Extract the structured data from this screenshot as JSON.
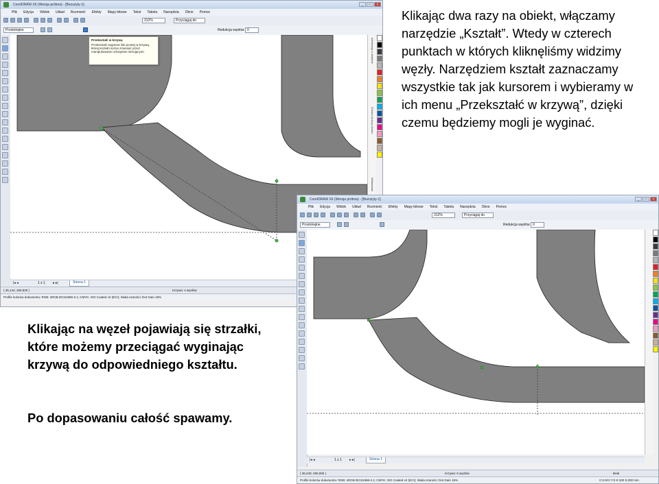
{
  "captions": {
    "top": "Klikając dwa razy na obiekt, włączamy narzędzie „Kształt”. Wtedy w czterech punktach w których kliknęliśmy widzimy węzły. Narzędziem kształt zaznaczamy wszystkie tak jak kursorem i wybieramy w ich menu „Przekształć w krzywą”, dzięki czemu będziemy mogli je wyginać.",
    "bottom": "Klikając na węzeł pojawiają się strzałki, które możemy przeciągać wyginając krzywą do odpowiedniego kształtu.",
    "final": "Po dopasowaniu całość spawamy."
  },
  "screenshot1": {
    "title": "CorelDRAW X6 (Wersja próbna) - [Bezużyty-1]",
    "menu": [
      "Plik",
      "Edycja",
      "Widok",
      "Układ",
      "Rozmieść",
      "Efekty",
      "Mapy bitowe",
      "Tekst",
      "Tabela",
      "Narzędzia",
      "Okno",
      "Pomoc"
    ],
    "zoom": "312%",
    "snap_label": "Przyciągaj do",
    "preset": "Prostokątne",
    "node_reduction_label": "Redukcja węzłów",
    "node_reduction_value": "0",
    "tooltip_title": "Przekształć w krzywą",
    "tooltip_text": "Przekształć segment linii prostej w krzywą, której kształt można zmieniać przez manipulowanie uchwytami sterującymi.",
    "page_counter": "1 z 1",
    "page_tab": "Strona 1",
    "coords": "( 35,144; 490,830 )",
    "node_info": "Krzywa: 4 węzłów",
    "color_profile": "Profile kolorów dokumentu: RGB: sRGB IEC61966-2.1; CMYK: ISO Coated v2 (ECI); Skala szarości: Dot Gain 15%",
    "docker_tabs": [
      "Informacje o obiekcie",
      "Zobacz krok-po-kroku",
      "Wskazówki"
    ]
  },
  "screenshot2": {
    "title": "CorelDRAW X6 (Wersja próbna) - [Bezużyty-1]",
    "menu": [
      "Plik",
      "Edycja",
      "Widok",
      "Układ",
      "Rozmieść",
      "Efekty",
      "Mapy bitowe",
      "Tekst",
      "Tabela",
      "Narzędzia",
      "Okno",
      "Pomoc"
    ],
    "zoom": "312%",
    "snap_label": "Przyciągaj do",
    "preset": "Prostokątne",
    "node_reduction_label": "Redukcja węzłów",
    "node_reduction_value": "0",
    "page_counter": "1 z 1",
    "page_tab": "Strona 1",
    "coords": "( 36,240; 490,005 )",
    "node_info": "Krzywa: 6 węzłów",
    "color_profile": "Profile kolorów dokumentu: RGB: sRGB IEC61966-2.1; CMYK: ISO Coated v2 (ECI); Skala szarości: Dot Gain 15%",
    "status_right": "C:0 M:0 Y:0 K:100  0,200 mm",
    "fill_none": "Brak"
  },
  "colors": {
    "shape_gray": "#808080",
    "shape_outline": "#222222",
    "node_green": "#4cb04c",
    "guide_dots": "#3a3a3a"
  },
  "palette": [
    "#ffffff",
    "#000000",
    "#3a3a3a",
    "#7a7a7a",
    "#b5b5b5",
    "#e31e24",
    "#f07e26",
    "#ffde17",
    "#8dc63f",
    "#00a651",
    "#00aeef",
    "#0054a6",
    "#662d91",
    "#ec008c",
    "#f49ac1",
    "#8b5a2b",
    "#c7b299",
    "#fff200"
  ]
}
